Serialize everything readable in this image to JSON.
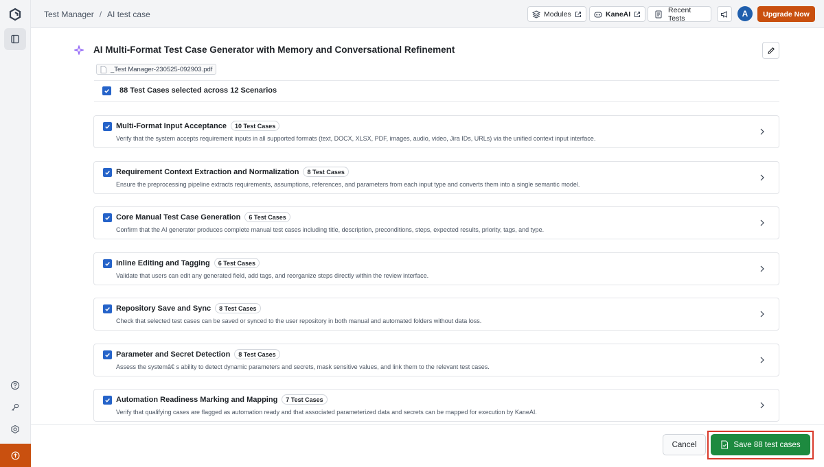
{
  "breadcrumb": {
    "root": "Test Manager",
    "separator": "/",
    "current": "AI test case"
  },
  "header": {
    "modules_label": "Modules",
    "kaneai_label": "KaneAI",
    "recent_tests_label": "Recent Tests",
    "avatar_initial": "A",
    "upgrade_label": "Upgrade Now"
  },
  "page": {
    "title": "AI Multi-Format Test Case Generator with Memory and Conversational Refinement",
    "file_name": "_Test Manager-230525-092903.pdf",
    "selection_summary": "88 Test Cases selected across 12 Scenarios"
  },
  "scenarios": [
    {
      "title": "Multi-Format Input Acceptance",
      "count": "10 Test Cases",
      "description": "Verify that the system accepts requirement inputs in all supported formats (text, DOCX, XLSX, PDF, images, audio, video, Jira IDs, URLs) via the unified context input interface."
    },
    {
      "title": "Requirement Context Extraction and Normalization",
      "count": "8 Test Cases",
      "description": "Ensure the preprocessing pipeline extracts requirements, assumptions, references, and parameters from each input type and converts them into a single semantic model."
    },
    {
      "title": "Core Manual Test Case Generation",
      "count": "6 Test Cases",
      "description": "Confirm that the AI generator produces complete manual test cases including title, description, preconditions, steps, expected results, priority, tags, and type."
    },
    {
      "title": "Inline Editing and Tagging",
      "count": "6 Test Cases",
      "description": "Validate that users can edit any generated field, add tags, and reorganize steps directly within the review interface."
    },
    {
      "title": "Repository Save and Sync",
      "count": "8 Test Cases",
      "description": "Check that selected test cases can be saved or synced to the user repository in both manual and automated folders without data loss."
    },
    {
      "title": "Parameter and Secret Detection",
      "count": "8 Test Cases",
      "description": "Assess the systemâ€ s ability to detect dynamic parameters and secrets, mask sensitive values, and link them to the relevant test cases."
    },
    {
      "title": "Automation Readiness Marking and Mapping",
      "count": "7 Test Cases",
      "description": "Verify that qualifying cases are flagged as automation ready and that associated parameterized data and secrets can be mapped for execution by KaneAI."
    }
  ],
  "footer": {
    "cancel_label": "Cancel",
    "save_label": "Save 88 test cases"
  },
  "colors": {
    "accent": "#c9500f",
    "primary_blue": "#2563c9",
    "save_green": "#1d8a3f",
    "highlight_red": "#d93a2b"
  }
}
